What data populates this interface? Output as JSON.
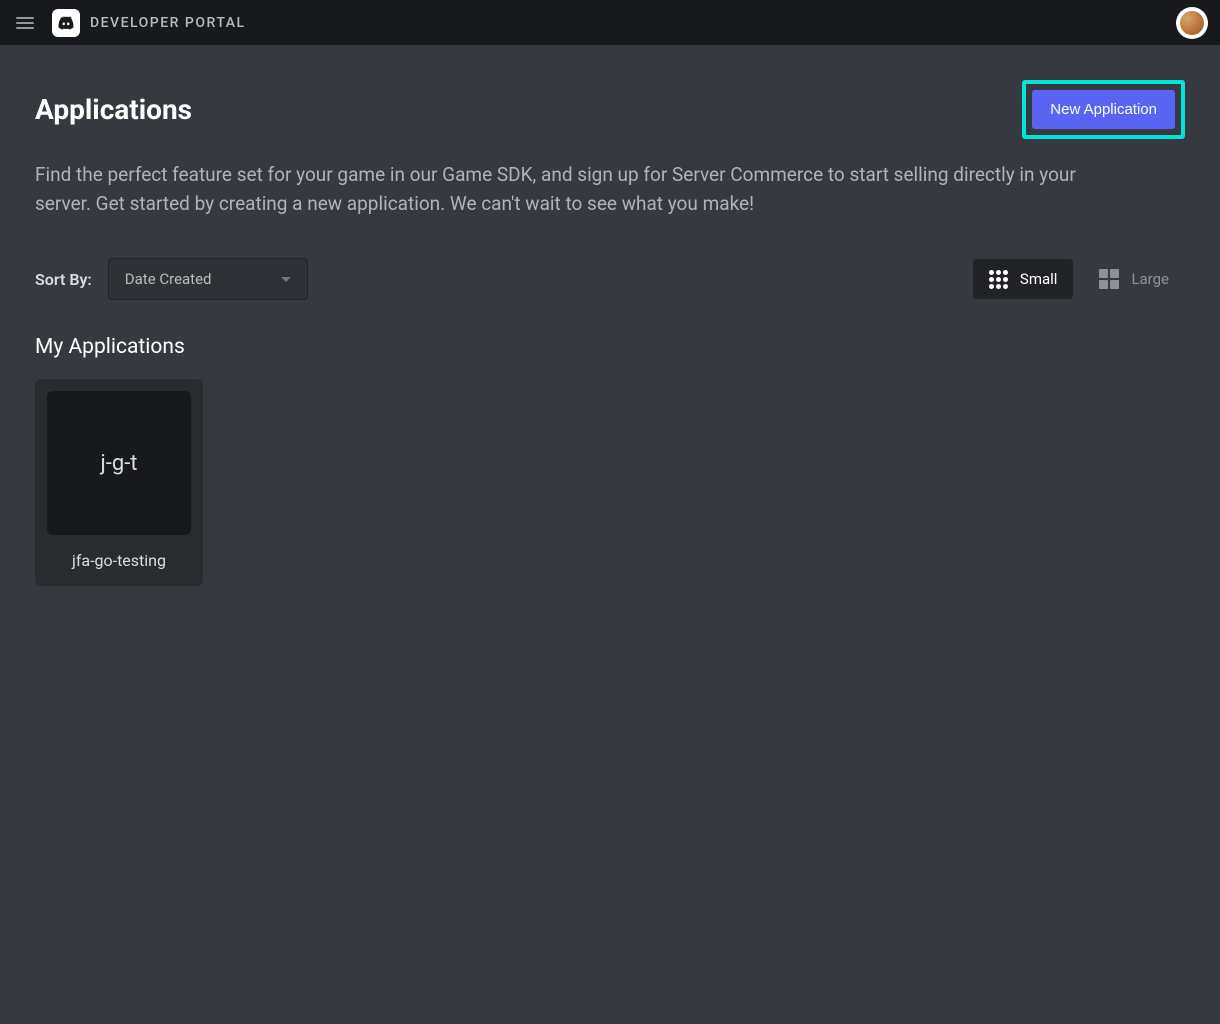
{
  "header": {
    "portal_title": "DEVELOPER PORTAL"
  },
  "page": {
    "title": "Applications",
    "new_app_button": "New Application",
    "description": "Find the perfect feature set for your game in our Game SDK, and sign up for Server Commerce to start selling directly in your server. Get started by creating a new application. We can't wait to see what you make!",
    "sort_label": "Sort By:",
    "sort_value": "Date Created",
    "view_small": "Small",
    "view_large": "Large",
    "section_title": "My Applications"
  },
  "applications": [
    {
      "initials": "j-g-t",
      "name": "jfa-go-testing"
    }
  ]
}
